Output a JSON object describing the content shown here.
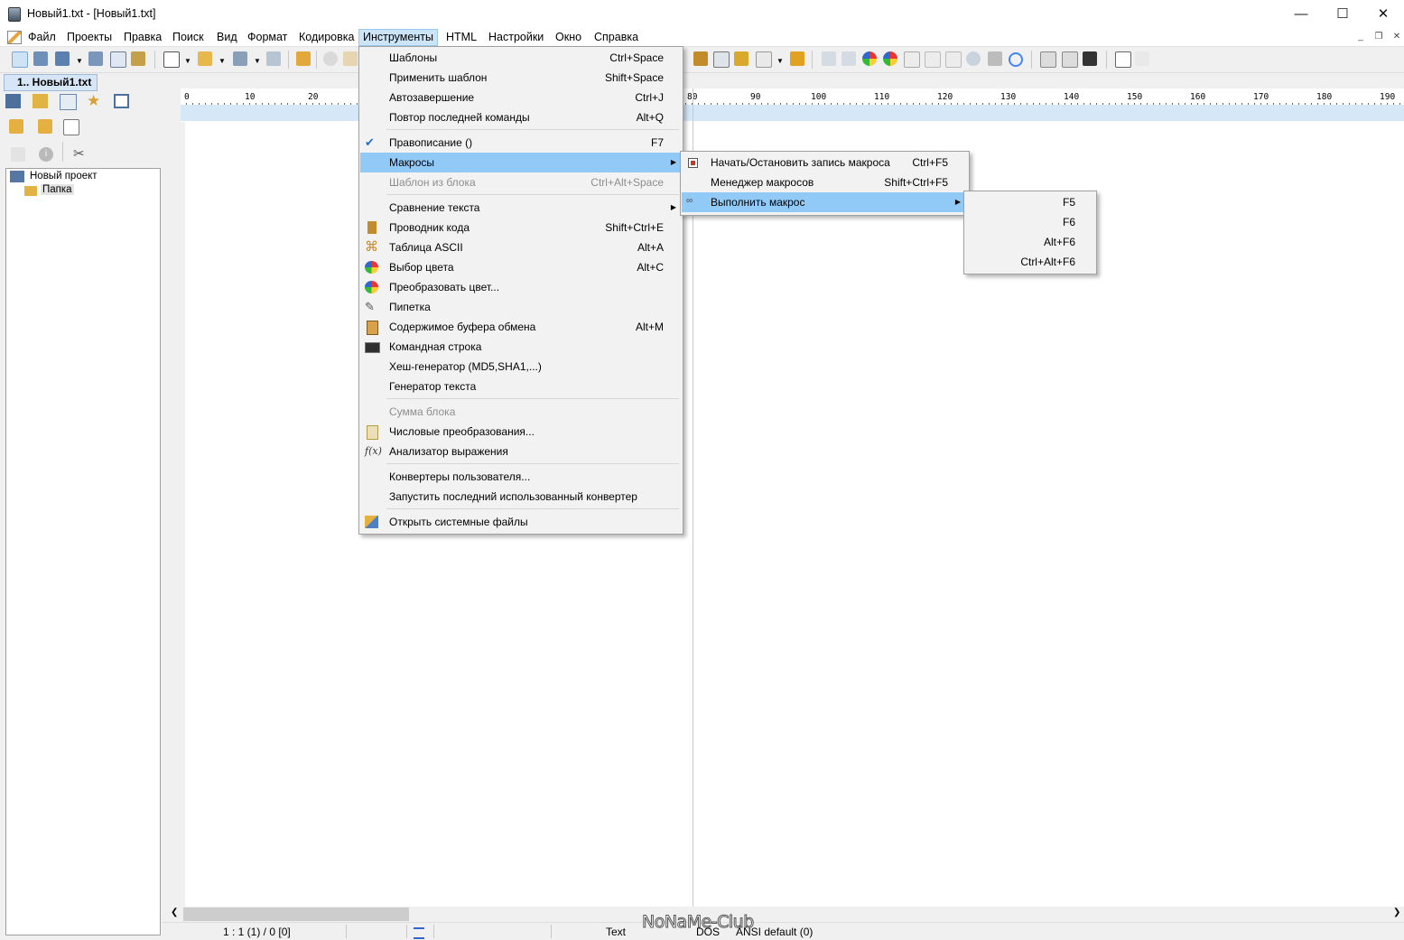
{
  "window": {
    "title": "Новый1.txt - [Новый1.txt]",
    "minimize": "—",
    "maximize": "☐",
    "close": "✕"
  },
  "menubar": {
    "items": [
      "Файл",
      "Проекты",
      "Правка",
      "Поиск",
      "Вид",
      "Формат",
      "Кодировка",
      "Инструменты",
      "HTML",
      "Настройки",
      "Окно",
      "Справка"
    ],
    "active": "Инструменты"
  },
  "document_tab": {
    "label": "1.. Новый1.txt"
  },
  "tree": {
    "project": "Новый проект",
    "folder": "Папка"
  },
  "ruler": {
    "labels": [
      "0",
      "10",
      "20",
      "80",
      "90",
      "100",
      "110",
      "120",
      "130",
      "140",
      "150",
      "160",
      "170",
      "180",
      "190"
    ]
  },
  "tools_menu": {
    "items": [
      {
        "label": "Шаблоны",
        "shortcut": "Ctrl+Space",
        "icon": "none"
      },
      {
        "label": "Применить шаблон",
        "shortcut": "Shift+Space",
        "icon": "none"
      },
      {
        "label": "Автозавершение",
        "shortcut": "Ctrl+J",
        "icon": "none"
      },
      {
        "label": "Повтор последней команды",
        "shortcut": "Alt+Q",
        "icon": "none"
      },
      {
        "label": "Правописание  ()",
        "shortcut": "F7",
        "icon": "spellcheck-icon"
      },
      {
        "label": "Макросы",
        "shortcut": "",
        "icon": "none",
        "submenu": true,
        "selected": true
      },
      {
        "label": "Шаблон из блока",
        "shortcut": "Ctrl+Alt+Space",
        "icon": "none",
        "disabled": true
      },
      {
        "label": "Сравнение текста",
        "shortcut": "",
        "icon": "none",
        "submenu": true
      },
      {
        "label": "Проводник кода",
        "shortcut": "Shift+Ctrl+E",
        "icon": "code-explorer-icon"
      },
      {
        "label": "Таблица ASCII",
        "shortcut": "Alt+A",
        "icon": "ascii-table-icon"
      },
      {
        "label": "Выбор цвета",
        "shortcut": "Alt+C",
        "icon": "color-picker-icon"
      },
      {
        "label": "Преобразовать цвет...",
        "shortcut": "",
        "icon": "color-convert-icon"
      },
      {
        "label": "Пипетка",
        "shortcut": "",
        "icon": "pipette-icon"
      },
      {
        "label": "Содержимое буфера обмена",
        "shortcut": "Alt+M",
        "icon": "clipboard-icon"
      },
      {
        "label": "Командная строка",
        "shortcut": "",
        "icon": "command-line-icon"
      },
      {
        "label": "Хеш-генератор (MD5,SHA1,...)",
        "shortcut": "",
        "icon": "none"
      },
      {
        "label": "Генератор текста",
        "shortcut": "",
        "icon": "none"
      },
      {
        "label": "Сумма блока",
        "shortcut": "",
        "icon": "none",
        "disabled": true
      },
      {
        "label": "Числовые преобразования...",
        "shortcut": "",
        "icon": "number-convert-icon"
      },
      {
        "label": "Анализатор выражения",
        "shortcut": "",
        "icon": "function-icon"
      },
      {
        "label": "Конвертеры пользователя...",
        "shortcut": "",
        "icon": "none"
      },
      {
        "label": "Запустить последний использованный конвертер",
        "shortcut": "",
        "icon": "none"
      },
      {
        "label": "Открыть системные файлы",
        "shortcut": "",
        "icon": "system-files-icon"
      }
    ]
  },
  "macros_menu": {
    "items": [
      {
        "label": "Начать/Остановить запись макроса",
        "shortcut": "Ctrl+F5",
        "icon": "record-icon"
      },
      {
        "label": "Менеджер макросов",
        "shortcut": "Shift+Ctrl+F5",
        "icon": "none"
      },
      {
        "label": "Выполнить макрос",
        "shortcut": "",
        "icon": "play-macro-icon",
        "submenu": true,
        "selected": true
      }
    ]
  },
  "run_macro_menu": {
    "items": [
      "F5",
      "F6",
      "Alt+F6",
      "Ctrl+Alt+F6"
    ]
  },
  "statusbar": {
    "position": "1 : 1 (1) / 0  [0]",
    "mode": "Text",
    "format": "DOS",
    "encoding": "ANSI default (0)"
  },
  "watermark": "NoNaMe-Club",
  "colors": {
    "menu_highlight": "#91c9f7",
    "menubar_active": "#cce4f7",
    "ruler_highlight": "#d6e8f8"
  }
}
